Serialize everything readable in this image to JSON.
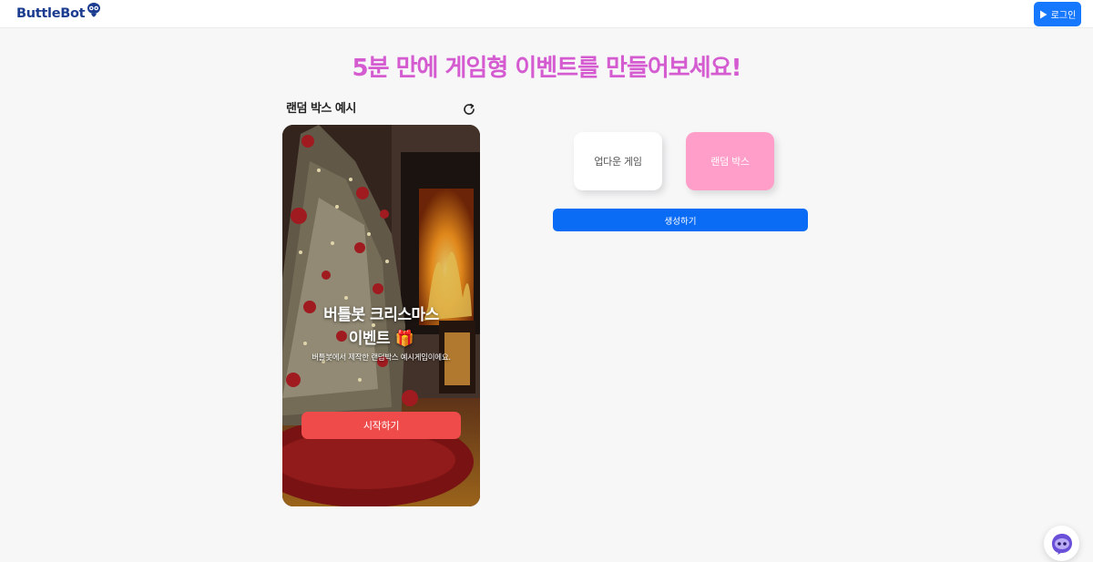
{
  "header": {
    "logo_text": "ButtleBot",
    "login_label": "로그인"
  },
  "hero": {
    "title": "5분 만에 게임형 이벤트를 만들어보세요!"
  },
  "preview": {
    "label": "랜덤 박스 예시",
    "event_title_line1": "버틀봇 크리스마스",
    "event_title_line2": "이벤트 🎁",
    "event_subtitle": "버틀봇에서 제작한 랜덤박스 예시게임이에요.",
    "start_label": "시작하기"
  },
  "game_types": {
    "updown_label": "업다운 게임",
    "random_label": "랜덤 박스",
    "selected": "랜덤 박스"
  },
  "actions": {
    "create_label": "생성하기"
  },
  "colors": {
    "accent": "#1677ff",
    "hero_title": "#d45bd0",
    "random_box": "#ff9ec9",
    "start_button": "#ef4b4b",
    "logo": "#1b3c8f"
  },
  "icons": {
    "login": "play-icon",
    "refresh": "refresh-icon",
    "chat": "chatbot-icon"
  }
}
